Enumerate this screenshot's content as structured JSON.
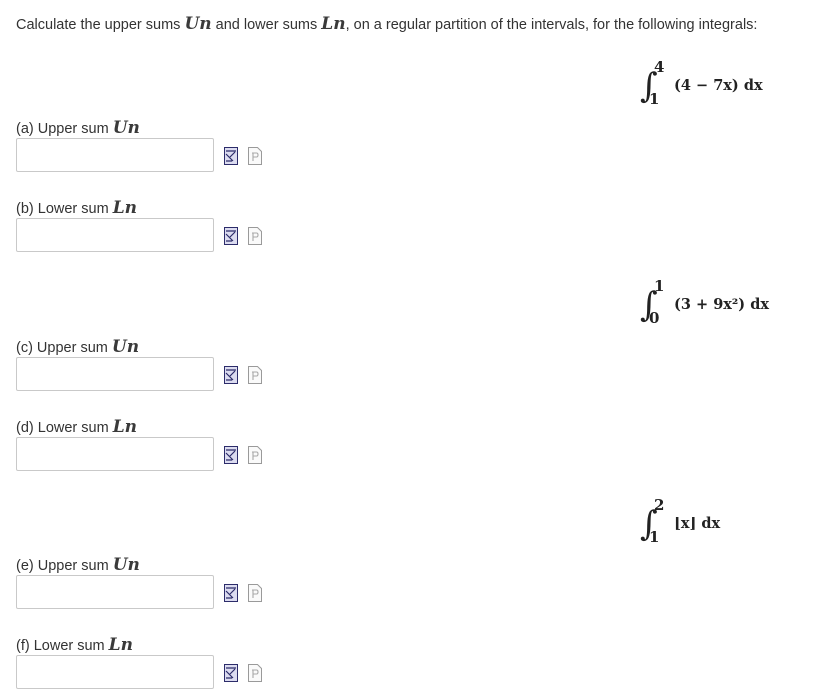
{
  "prompt": {
    "text_before_u": "Calculate the upper sums ",
    "u_var": "Un",
    "text_middle": " and lower sums ",
    "l_var": "Ln",
    "text_after": ", on a regular partition of the intervals, for the following integrals:"
  },
  "integrals": [
    {
      "upper": "4",
      "lower": "1",
      "integrand": "(4 − 7x) dx"
    },
    {
      "upper": "1",
      "lower": "0",
      "integrand": "(3 + 9x²) dx"
    },
    {
      "upper": "2",
      "lower": "1",
      "integrand": "⌊x⌋ dx"
    }
  ],
  "answers": [
    {
      "label": "(a) Upper sum ",
      "var": "Un",
      "value": "",
      "placeholder": ""
    },
    {
      "label": "(b) Lower sum ",
      "var": "Ln",
      "value": "",
      "placeholder": ""
    },
    {
      "label": "(c) Upper sum ",
      "var": "Un",
      "value": "",
      "placeholder": ""
    },
    {
      "label": "(d) Lower sum ",
      "var": "Ln",
      "value": "",
      "placeholder": ""
    },
    {
      "label": "(e) Upper sum ",
      "var": "Un",
      "value": "",
      "placeholder": ""
    },
    {
      "label": "(f) Lower sum ",
      "var": "Ln",
      "value": "",
      "placeholder": ""
    }
  ],
  "icons": {
    "preview": "preview-formula-icon",
    "help": "help-page-icon"
  },
  "colors": {
    "text": "#333333",
    "input_border": "#c9c9c9",
    "preview_icon": "#2c2c6a",
    "help_icon": "#9a9a9a"
  }
}
